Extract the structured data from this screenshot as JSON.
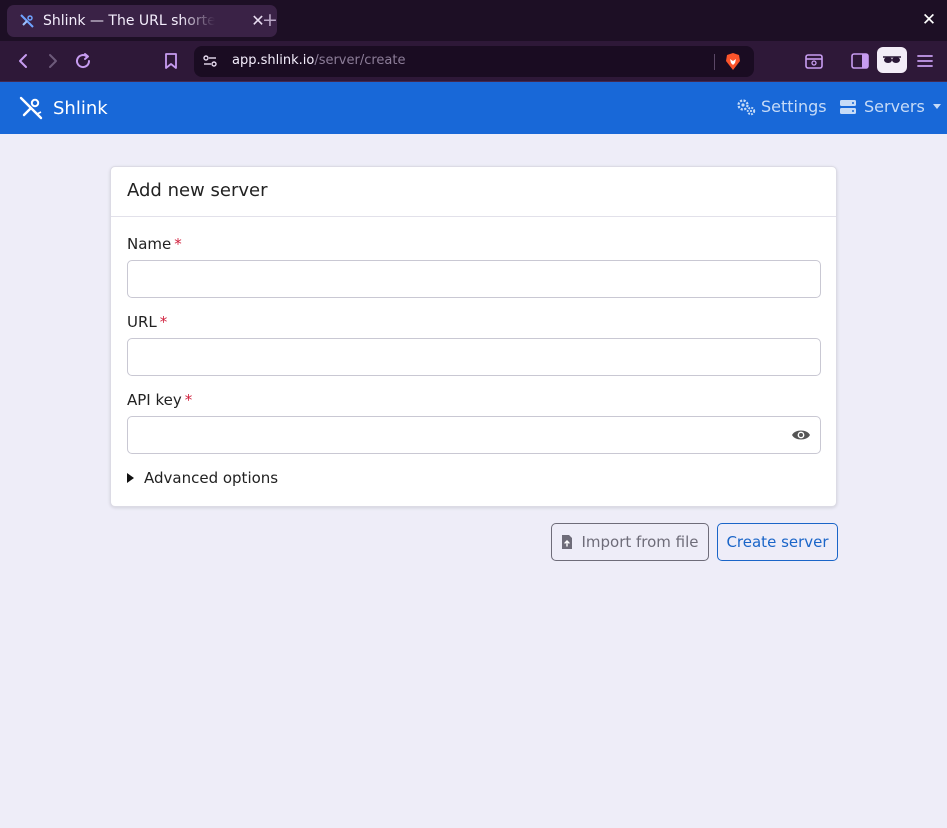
{
  "browser": {
    "tab_title": "Shlink — The URL shortener",
    "url_host": "app.shlink.io",
    "url_path": "/server/create",
    "icons": [
      "back-icon",
      "forward-icon",
      "reload-icon",
      "bookmark-icon",
      "site-info-icon",
      "brave-shields-icon",
      "tab-search-icon",
      "sidebar-icon",
      "reader-mode-icon",
      "menu-icon"
    ]
  },
  "navbar": {
    "brand": "Shlink",
    "settings_label": "Settings",
    "servers_label": "Servers"
  },
  "form": {
    "title": "Add new server",
    "name_label": "Name",
    "url_label": "URL",
    "api_key_label": "API key",
    "required_mark": "*",
    "name_value": "",
    "url_value": "",
    "api_key_value": "",
    "advanced_label": "Advanced options"
  },
  "actions": {
    "import_label": "Import from file",
    "create_label": "Create server"
  },
  "colors": {
    "navbar": "#1868d8",
    "background": "#eeedf8",
    "required": "#d01f3c",
    "primary": "#1a65c8"
  }
}
